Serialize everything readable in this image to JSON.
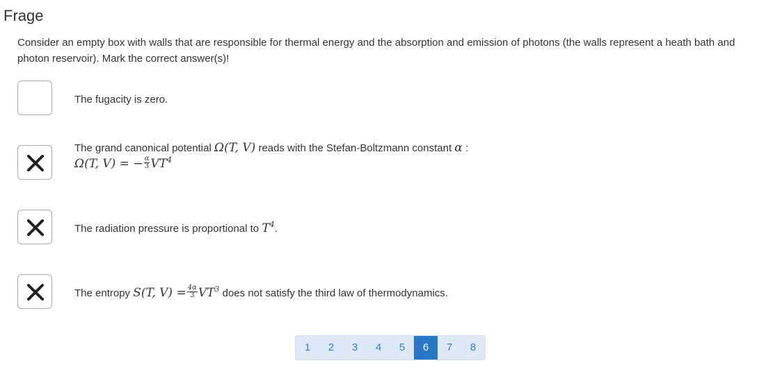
{
  "title": "Frage",
  "question": "Consider an empty box with walls that are responsible for thermal energy and the absorption and emission of photons (the walls represent a heath bath and photon reservoir). Mark the correct answer(s)!",
  "options": [
    {
      "checked": false,
      "text": "The fugacity is zero."
    },
    {
      "checked": true,
      "text_before": "The grand canonical potential",
      "omega": "Ω(T, V)",
      "text_middle": "reads with the Stefan-Boltzmann constant",
      "alpha": "α",
      "text_after": ":",
      "formula_lhs": "Ω(T, V) = −",
      "frac_num": "α",
      "frac_den": "3",
      "formula_rhs": "VT",
      "formula_exp": "4"
    },
    {
      "checked": true,
      "text_before": "The radiation pressure is proportional to",
      "math_base": "T",
      "math_exp": "4",
      "text_after": "."
    },
    {
      "checked": true,
      "text_before": "The entropy",
      "formula_lhs": "S(T, V) =",
      "frac_num": "4α",
      "frac_den": "3",
      "formula_rhs": "VT",
      "formula_exp": "3",
      "text_after": "does not satisfy the third law of thermodynamics."
    }
  ],
  "pagination": {
    "pages": [
      "1",
      "2",
      "3",
      "4",
      "5",
      "6",
      "7",
      "8"
    ],
    "current": "6"
  },
  "colors": {
    "accent": "#2878c6",
    "pager_bg": "#dde9f6",
    "pager_text": "#2f7fc9",
    "check_mark": "#222222"
  },
  "icons": {
    "checked": "x-mark-icon"
  }
}
